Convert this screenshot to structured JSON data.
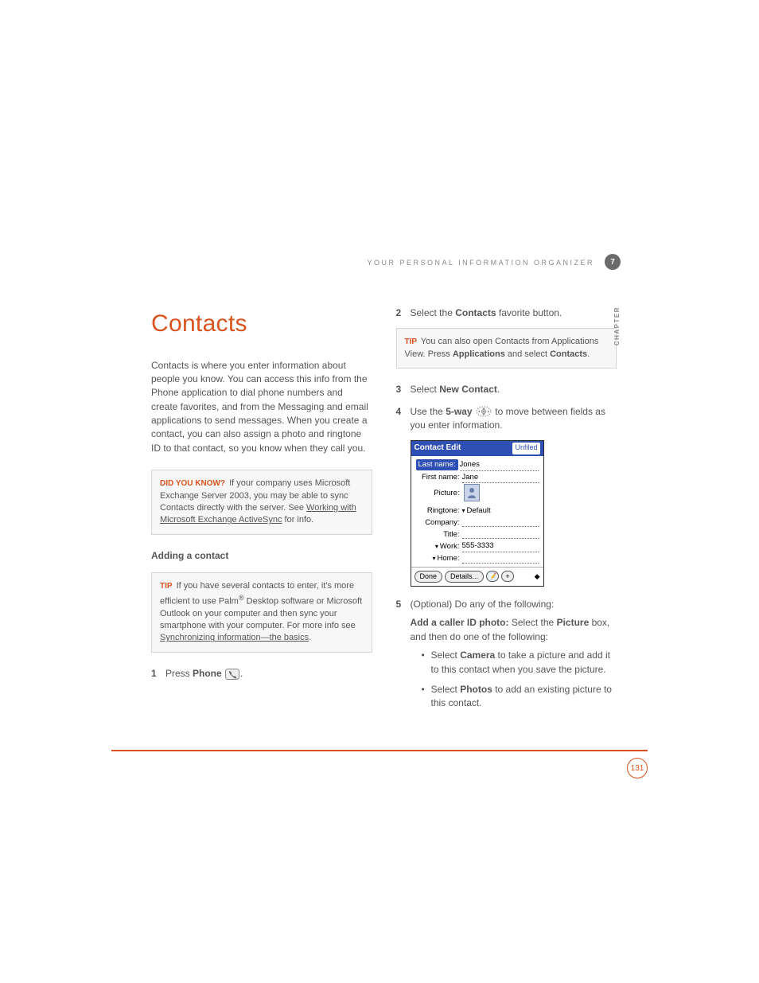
{
  "header": {
    "running": "YOUR PERSONAL INFORMATION ORGANIZER",
    "chapter_num": "7",
    "chapter_label": "CHAPTER"
  },
  "title": "Contacts",
  "intro": "Contacts is where you enter information about people you know. You can access this info from the Phone application to dial phone numbers and create favorites, and from the Messaging and email applications to send messages. When you create a contact, you can also assign a photo and ringtone ID to that contact, so you know when they call you.",
  "dyk": {
    "tag": "DID YOU KNOW?",
    "text_before": "If your company uses Microsoft Exchange Server 2003, you may be able to sync Contacts directly with the server. See ",
    "link": "Working with Microsoft Exchange ActiveSync",
    "text_after": " for info."
  },
  "subhead": "Adding a contact",
  "tip1": {
    "tag": "TIP",
    "text_before": "If you have several contacts to enter, it's more efficient to use Palm",
    "reg": "®",
    "text_mid": " Desktop software or Microsoft Outlook on your computer and then sync your smartphone with your computer. For more info see ",
    "link": "Synchronizing information—the basics",
    "text_after": "."
  },
  "step1": {
    "num": "1",
    "a": "Press ",
    "b": "Phone",
    "c": " ",
    "icon": "phone-key-icon",
    "d": "."
  },
  "step2": {
    "num": "2",
    "a": "Select the ",
    "b": "Contacts",
    "c": " favorite button."
  },
  "tip2": {
    "tag": "TIP",
    "a": "You can also open Contacts from Applications View. Press ",
    "b": "Applications",
    "c": " and select ",
    "d": "Contacts",
    "e": "."
  },
  "step3": {
    "num": "3",
    "a": "Select ",
    "b": "New Contact",
    "c": "."
  },
  "step4": {
    "num": "4",
    "a": "Use the ",
    "b": "5-way",
    "c": " ",
    "icon": "five-way-icon",
    "d": " to move between fields as you enter information."
  },
  "screenshot": {
    "title": "Contact Edit",
    "category": "Unfiled",
    "lastname_label": "Last name:",
    "lastname_val": "Jones",
    "firstname_label": "First name:",
    "firstname_val": "Jane",
    "picture_label": "Picture:",
    "ringtone_label": "Ringtone:",
    "ringtone_val": "Default",
    "company_label": "Company:",
    "title_label": "Title:",
    "work_label": "Work:",
    "work_val": "555-3333",
    "home_label": "Home:",
    "btn_done": "Done",
    "btn_details": "Details...",
    "btn_note": "📝",
    "btn_add": "+"
  },
  "step5": {
    "num": "5",
    "lead": "(Optional)  Do any of the following:",
    "p1a": "Add a caller ID photo:",
    "p1b": " Select the ",
    "p1c": "Picture",
    "p1d": " box, and then do one of the following:",
    "b1a": "Select ",
    "b1b": "Camera",
    "b1c": " to take a picture and add it to this contact when you save the picture.",
    "b2a": "Select ",
    "b2b": "Photos",
    "b2c": " to add an existing picture to this contact."
  },
  "pagenum": "131"
}
